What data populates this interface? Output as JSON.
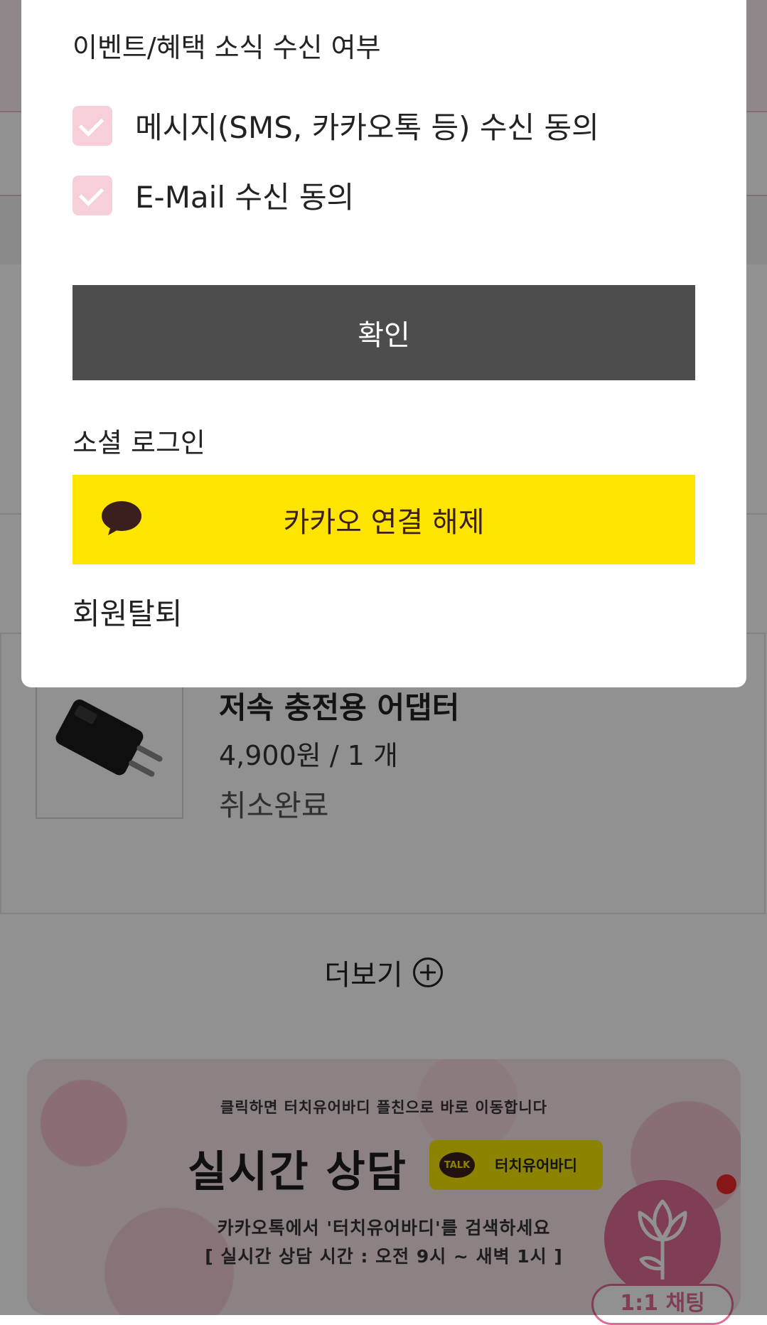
{
  "modal": {
    "consent_heading": "이벤트/혜택 소식 수신 여부",
    "consents": [
      {
        "label": "메시지(SMS, 카카오톡 등) 수신 동의",
        "checked": true
      },
      {
        "label": "E-Mail 수신 동의",
        "checked": true
      }
    ],
    "confirm_label": "확인",
    "social_heading": "소셜 로그인",
    "kakao_label": "카카오 연결 해제",
    "withdraw_label": "회원탈퇴"
  },
  "order": {
    "product_name": "저속 충전용 어댑터",
    "price_qty": "4,900원 / 1 개",
    "status": "취소완료"
  },
  "more_label": "더보기",
  "banner": {
    "sub": "클릭하면 터치유어바디 플친으로 바로 이동합니다",
    "title": "실시간 상담",
    "talk_badge": "TALK",
    "talk_name": "터치유어바디",
    "line1": "카카오톡에서 '터치유어바디'를 검색하세요",
    "line2": "[ 실시간 상담 시간 : 오전 9시 ~ 새벽 1시 ]"
  },
  "chat_button": "1:1 채팅",
  "colors": {
    "checkbox": "#f6cfd9",
    "confirm_bg": "#4d4d4d",
    "kakao_yellow": "#fee500",
    "brand_pink": "#e06b98"
  },
  "icons": [
    "check-icon",
    "kakao-talk-icon",
    "plus-circle-icon",
    "charger-image",
    "tulip-icon"
  ]
}
